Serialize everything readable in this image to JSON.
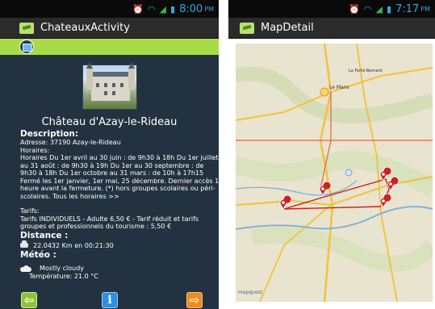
{
  "left_screen": {
    "status": {
      "time": "8:00",
      "ampm": "PM"
    },
    "app_title": "ChateauxActivity",
    "chateau_name": "Château d'Azay-le-Rideau",
    "description_heading": "Description:",
    "address": "Adresse: 37190 Azay-le-Rideau",
    "horaires_label": "Horaires:",
    "horaires_text": "Horaires Du 1er avril au 30 juin : de 9h30 à 18h Du 1er juillet au 31 août : de 9h30 à 19h Du 1er au 30 septembre : de 9h30 à 18h Du 1er octobre au 31 mars : de 10h à 17h15 Fermé les 1er janvier, 1er mai, 25 décembre. Dernier accès 1 heure avant la fermeture. (*) hors groupes scolaires ou péri-scolaires. Tous les horaires >>",
    "tarifs_label": "Tarifs:",
    "tarifs_text": "Tarifs INDIVIDUELS - Adulte 6,50 € - Tarif réduit et tarifs groupes et professionnels du tourisme : 5,50 €",
    "distance_heading": "Distance :",
    "distance_value": "22.0432 Km en 00:21:30",
    "meteo_heading": "Météo :",
    "weather_condition": "Mostly cloudy",
    "temperature": "Température: 21.0 °C",
    "buttons": {
      "back": "⇦",
      "info": "i",
      "next": "⇨"
    }
  },
  "right_screen": {
    "status": {
      "time": "7:17",
      "ampm": "PM"
    },
    "app_title": "MapDetail",
    "attribution": "mapquest",
    "map_labels": [
      "Le Mans",
      "La Ferté-Bernard"
    ]
  },
  "icons": [
    "alarm-icon",
    "wifi-icon",
    "signal-icon",
    "battery-icon",
    "app-icon",
    "map-icon",
    "car-icon",
    "cloud-icon",
    "map-marker-icon"
  ],
  "colors": {
    "accent_green": "#a8dc46",
    "content_bg": "#233240",
    "route_red": "#cc1f1f",
    "back_btn": "#8fc23c",
    "info_btn": "#2f8fdc",
    "next_btn": "#f28a1c"
  }
}
